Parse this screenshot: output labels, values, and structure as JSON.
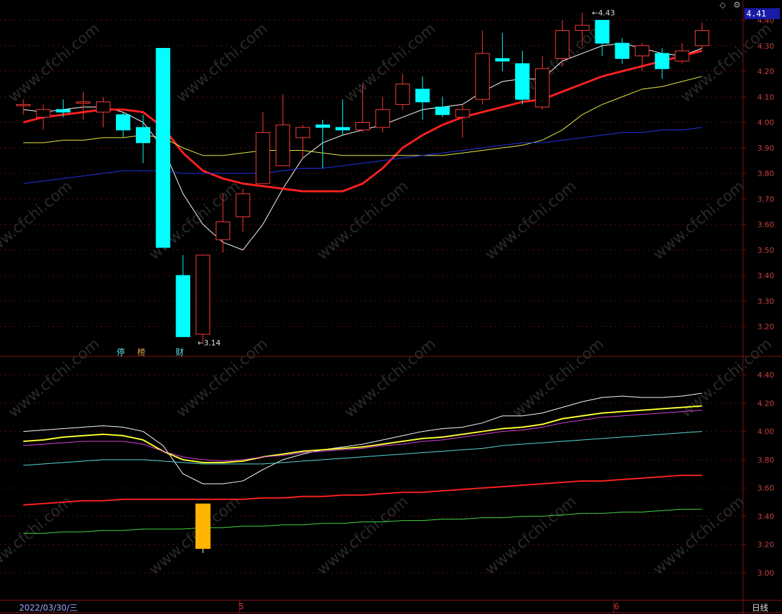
{
  "header": {
    "current_price_label": "4.41",
    "diamond_icon": "diamond-icon",
    "settings_icon": "gear-icon"
  },
  "footer": {
    "start_date": "2022/03/30/三",
    "months": [
      "5",
      "6"
    ],
    "period": "日线"
  },
  "tags": [
    {
      "text": "停",
      "color": "#5fe0e0"
    },
    {
      "text": "榜",
      "color": "#e0a050"
    },
    {
      "text": "财",
      "color": "#5fe0e0"
    }
  ],
  "annotations": {
    "high_label": "4.43",
    "low_label": "3.14"
  },
  "chart_data": [
    {
      "type": "candlestick",
      "panel": "main",
      "ylim": [
        3.1,
        4.43
      ],
      "yticks": [
        "4.40",
        "4.30",
        "4.20",
        "4.10",
        "4.00",
        "3.90",
        "3.80",
        "3.70",
        "3.60",
        "3.50",
        "3.40",
        "3.30",
        "3.20"
      ],
      "candles": [
        {
          "o": 4.07,
          "c": 4.07,
          "h": 4.09,
          "l": 4.03
        },
        {
          "o": 4.02,
          "c": 4.05,
          "h": 4.07,
          "l": 3.97
        },
        {
          "o": 4.05,
          "c": 4.04,
          "h": 4.09,
          "l": 4.02
        },
        {
          "o": 4.08,
          "c": 4.08,
          "h": 4.12,
          "l": 4.01
        },
        {
          "o": 4.04,
          "c": 4.08,
          "h": 4.1,
          "l": 3.98
        },
        {
          "o": 4.03,
          "c": 3.97,
          "h": 4.04,
          "l": 3.94
        },
        {
          "o": 3.98,
          "c": 3.92,
          "h": 4.03,
          "l": 3.84
        },
        {
          "o": 4.29,
          "c": 3.51,
          "h": 4.29,
          "l": 3.51
        },
        {
          "o": 3.4,
          "c": 3.16,
          "h": 3.48,
          "l": 3.16
        },
        {
          "o": 3.17,
          "c": 3.48,
          "h": 3.48,
          "l": 3.14
        },
        {
          "o": 3.54,
          "c": 3.61,
          "h": 3.72,
          "l": 3.49
        },
        {
          "o": 3.63,
          "c": 3.72,
          "h": 3.74,
          "l": 3.57
        },
        {
          "o": 3.76,
          "c": 3.96,
          "h": 4.04,
          "l": 3.76
        },
        {
          "o": 3.83,
          "c": 3.99,
          "h": 4.11,
          "l": 3.83
        },
        {
          "o": 3.94,
          "c": 3.98,
          "h": 3.99,
          "l": 3.86
        },
        {
          "o": 3.99,
          "c": 3.98,
          "h": 4.01,
          "l": 3.82
        },
        {
          "o": 3.98,
          "c": 3.97,
          "h": 4.09,
          "l": 3.95
        },
        {
          "o": 3.97,
          "c": 4.0,
          "h": 4.15,
          "l": 3.96
        },
        {
          "o": 3.98,
          "c": 4.05,
          "h": 4.1,
          "l": 3.96
        },
        {
          "o": 4.07,
          "c": 4.15,
          "h": 4.19,
          "l": 4.05
        },
        {
          "o": 4.13,
          "c": 4.08,
          "h": 4.18,
          "l": 4.01
        },
        {
          "o": 4.06,
          "c": 4.03,
          "h": 4.1,
          "l": 4.02
        },
        {
          "o": 4.02,
          "c": 4.05,
          "h": 4.07,
          "l": 3.94
        },
        {
          "o": 4.09,
          "c": 4.27,
          "h": 4.36,
          "l": 4.07
        },
        {
          "o": 4.25,
          "c": 4.24,
          "h": 4.35,
          "l": 4.2
        },
        {
          "o": 4.23,
          "c": 4.09,
          "h": 4.28,
          "l": 4.07
        },
        {
          "o": 4.06,
          "c": 4.21,
          "h": 4.26,
          "l": 4.05
        },
        {
          "o": 4.25,
          "c": 4.36,
          "h": 4.4,
          "l": 4.22
        },
        {
          "o": 4.36,
          "c": 4.38,
          "h": 4.43,
          "l": 4.3
        },
        {
          "o": 4.4,
          "c": 4.31,
          "h": 4.4,
          "l": 4.26
        },
        {
          "o": 4.31,
          "c": 4.25,
          "h": 4.33,
          "l": 4.23
        },
        {
          "o": 4.26,
          "c": 4.3,
          "h": 4.31,
          "l": 4.2
        },
        {
          "o": 4.27,
          "c": 4.21,
          "h": 4.29,
          "l": 4.17
        },
        {
          "o": 4.24,
          "c": 4.28,
          "h": 4.31,
          "l": 4.23
        },
        {
          "o": 4.3,
          "c": 4.36,
          "h": 4.39,
          "l": 4.29
        }
      ],
      "series": [
        {
          "color": "#ffffff",
          "width": 1,
          "values": [
            4.05,
            4.04,
            4.05,
            4.06,
            4.06,
            4.04,
            4.0,
            3.9,
            3.72,
            3.6,
            3.53,
            3.5,
            3.6,
            3.74,
            3.86,
            3.92,
            3.95,
            3.97,
            3.99,
            4.02,
            4.05,
            4.06,
            4.07,
            4.12,
            4.16,
            4.17,
            4.17,
            4.24,
            4.27,
            4.3,
            4.31,
            4.29,
            4.27,
            4.26,
            4.29
          ]
        },
        {
          "color": "#ff2020",
          "width": 3,
          "values": [
            4.0,
            4.02,
            4.03,
            4.04,
            4.05,
            4.05,
            4.04,
            3.98,
            3.88,
            3.81,
            3.78,
            3.76,
            3.75,
            3.74,
            3.73,
            3.73,
            3.73,
            3.76,
            3.82,
            3.9,
            3.95,
            3.99,
            4.02,
            4.04,
            4.06,
            4.08,
            4.09,
            4.12,
            4.15,
            4.18,
            4.2,
            4.22,
            4.24,
            4.26,
            4.28
          ]
        },
        {
          "color": "#eeee44",
          "width": 1,
          "values": [
            3.92,
            3.92,
            3.93,
            3.93,
            3.94,
            3.94,
            3.95,
            3.94,
            3.9,
            3.87,
            3.87,
            3.88,
            3.89,
            3.89,
            3.89,
            3.88,
            3.87,
            3.87,
            3.87,
            3.87,
            3.87,
            3.87,
            3.88,
            3.89,
            3.9,
            3.91,
            3.93,
            3.97,
            4.03,
            4.07,
            4.1,
            4.13,
            4.14,
            4.16,
            4.18
          ]
        },
        {
          "color": "#2233ee",
          "width": 1,
          "values": [
            3.76,
            3.77,
            3.78,
            3.79,
            3.8,
            3.81,
            3.81,
            3.81,
            3.8,
            3.8,
            3.8,
            3.8,
            3.8,
            3.81,
            3.82,
            3.82,
            3.83,
            3.84,
            3.85,
            3.86,
            3.87,
            3.88,
            3.89,
            3.9,
            3.91,
            3.92,
            3.92,
            3.93,
            3.94,
            3.95,
            3.96,
            3.96,
            3.97,
            3.97,
            3.98
          ]
        }
      ]
    },
    {
      "type": "line",
      "panel": "sub",
      "ylim": [
        2.91,
        4.48
      ],
      "yticks": [
        "4.40",
        "4.20",
        "4.00",
        "3.80",
        "3.60",
        "3.40",
        "3.20",
        "3.00"
      ],
      "series": [
        {
          "color": "#ffffff",
          "width": 1,
          "values": [
            4.0,
            4.01,
            4.02,
            4.03,
            4.04,
            4.03,
            4.0,
            3.9,
            3.7,
            3.63,
            3.63,
            3.65,
            3.73,
            3.8,
            3.84,
            3.87,
            3.89,
            3.91,
            3.94,
            3.97,
            4.0,
            4.02,
            4.03,
            4.06,
            4.11,
            4.11,
            4.13,
            4.17,
            4.21,
            4.24,
            4.25,
            4.24,
            4.24,
            4.25,
            4.27
          ]
        },
        {
          "color": "#ffff33",
          "width": 2,
          "values": [
            3.93,
            3.94,
            3.96,
            3.97,
            3.98,
            3.97,
            3.94,
            3.86,
            3.8,
            3.78,
            3.78,
            3.79,
            3.82,
            3.84,
            3.86,
            3.87,
            3.88,
            3.89,
            3.91,
            3.93,
            3.95,
            3.96,
            3.98,
            4.0,
            4.02,
            4.03,
            4.05,
            4.09,
            4.11,
            4.13,
            4.14,
            4.15,
            4.16,
            4.17,
            4.18
          ]
        },
        {
          "color": "#dd44dd",
          "width": 1,
          "values": [
            3.9,
            3.91,
            3.92,
            3.93,
            3.93,
            3.93,
            3.91,
            3.86,
            3.82,
            3.8,
            3.79,
            3.8,
            3.82,
            3.83,
            3.85,
            3.86,
            3.87,
            3.88,
            3.9,
            3.91,
            3.93,
            3.94,
            3.96,
            3.98,
            4.0,
            4.01,
            4.03,
            4.06,
            4.08,
            4.1,
            4.11,
            4.12,
            4.13,
            4.14,
            4.15
          ]
        },
        {
          "color": "#55dddd",
          "width": 1,
          "values": [
            3.76,
            3.77,
            3.78,
            3.79,
            3.8,
            3.8,
            3.8,
            3.79,
            3.78,
            3.77,
            3.77,
            3.77,
            3.77,
            3.78,
            3.79,
            3.8,
            3.81,
            3.82,
            3.83,
            3.84,
            3.85,
            3.86,
            3.87,
            3.88,
            3.9,
            3.91,
            3.92,
            3.93,
            3.94,
            3.95,
            3.96,
            3.97,
            3.98,
            3.99,
            4.0
          ]
        },
        {
          "color": "#ff2020",
          "width": 2,
          "values": [
            3.48,
            3.49,
            3.5,
            3.51,
            3.51,
            3.52,
            3.52,
            3.52,
            3.52,
            3.52,
            3.52,
            3.52,
            3.53,
            3.53,
            3.54,
            3.54,
            3.55,
            3.55,
            3.56,
            3.57,
            3.57,
            3.58,
            3.59,
            3.6,
            3.61,
            3.62,
            3.63,
            3.64,
            3.65,
            3.65,
            3.66,
            3.67,
            3.68,
            3.69,
            3.69
          ]
        },
        {
          "color": "#44dd44",
          "width": 1,
          "values": [
            3.28,
            3.28,
            3.29,
            3.29,
            3.3,
            3.3,
            3.31,
            3.31,
            3.31,
            3.32,
            3.32,
            3.33,
            3.33,
            3.34,
            3.34,
            3.35,
            3.35,
            3.36,
            3.36,
            3.37,
            3.37,
            3.38,
            3.38,
            3.39,
            3.39,
            3.4,
            3.4,
            3.41,
            3.42,
            3.42,
            3.43,
            3.43,
            3.44,
            3.45,
            3.45
          ]
        }
      ],
      "marker": {
        "index": 9,
        "top": 3.49,
        "bottom": 3.17,
        "color": "#ffb400"
      }
    }
  ]
}
